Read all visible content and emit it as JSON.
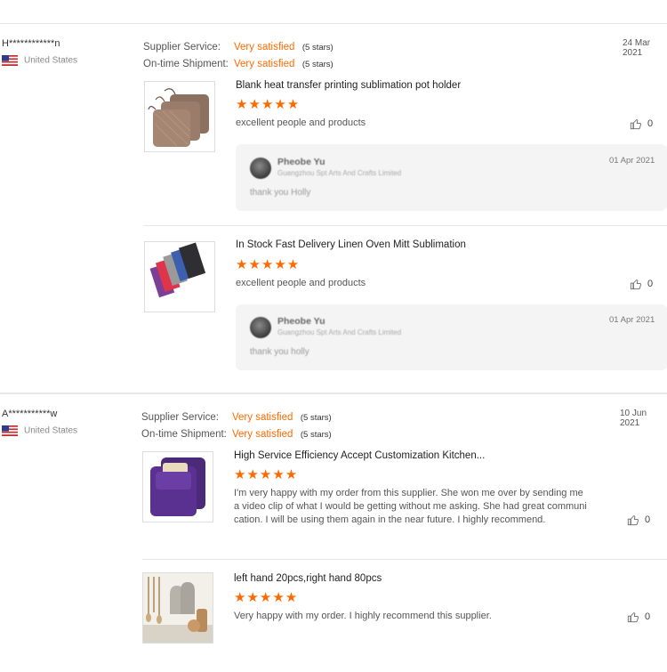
{
  "reviews": [
    {
      "buyer": "H************n",
      "country": "United States",
      "date": "24 Mar 2021",
      "supplier_service_label": "Supplier Service:",
      "supplier_service_value": "Very satisfied",
      "supplier_service_note": "(5 stars)",
      "shipment_label": "On-time Shipment:",
      "shipment_value": "Very satisfied",
      "shipment_note": "(5 stars)",
      "products": [
        {
          "title": "Blank heat transfer printing sublimation pot holder",
          "rating": 5,
          "stars": "★★★★★",
          "comment": "excellent people and products",
          "likes": "0",
          "reply": {
            "name": "Pheobe Yu",
            "company": "Guangzhou Spt Arts And Crafts Limited",
            "date": "01 Apr 2021",
            "text": "thank you Holly"
          }
        },
        {
          "title": "In Stock Fast Delivery Linen Oven Mitt Sublimation",
          "rating": 5,
          "stars": "★★★★★",
          "comment": "excellent people and products",
          "likes": "0",
          "reply": {
            "name": "Pheobe Yu",
            "company": "Guangzhou Spt Arts And Crafts Limited",
            "date": "01 Apr 2021",
            "text": "thank you holly"
          }
        }
      ]
    },
    {
      "buyer": "A***********w",
      "country": "United States",
      "date": "10 Jun 2021",
      "supplier_service_label": "Supplier Service:",
      "supplier_service_value": "Very satisfied",
      "supplier_service_note": "(5 stars)",
      "shipment_label": "On-time Shipment:",
      "shipment_value": "Very satisfied",
      "shipment_note": "(5 stars)",
      "products": [
        {
          "title": "High Service Efficiency Accept Customization Kitchen...",
          "rating": 5,
          "stars": "★★★★★",
          "comment_lines": [
            "I'm very happy with my order from this supplier. She won me over by sending me",
            "a video clip of what I would be getting without me asking. She had great communi",
            "cation. I will be using them again in the near future. I highly recommend."
          ],
          "likes": "0"
        },
        {
          "title": "left hand 20pcs,right hand 80pcs",
          "rating": 5,
          "stars": "★★★★★",
          "comment": "Very happy with my order. I highly recommend this supplier.",
          "likes": "0"
        }
      ]
    }
  ],
  "colors": {
    "accent": "#ff6a00",
    "reply_bg": "#f4f4f4",
    "divider": "#e3e3e3"
  },
  "icons": {
    "flag": "us-flag-icon",
    "like": "thumbs-up-icon",
    "star": "star-icon"
  }
}
